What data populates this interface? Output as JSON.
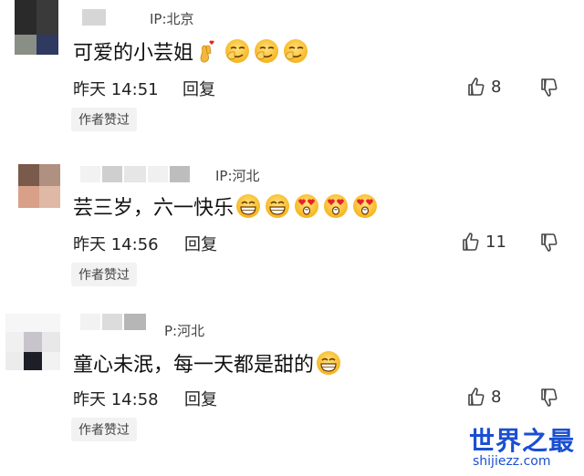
{
  "comments": [
    {
      "ip": "IP:北京",
      "text": "可爱的小芸姐",
      "emojis": [
        "finger-heart-emoji",
        "smirk-emoji",
        "smirk-emoji",
        "smirk-emoji"
      ],
      "time": "昨天 14:51",
      "reply": "回复",
      "likes": "8",
      "tag": "作者赞过"
    },
    {
      "ip": "IP:河北",
      "text": "芸三岁，六一快乐",
      "emojis": [
        "grin-emoji",
        "grin-emoji",
        "heart-eyes-emoji",
        "heart-eyes-emoji",
        "heart-eyes-emoji"
      ],
      "time": "昨天 14:56",
      "reply": "回复",
      "likes": "11",
      "tag": "作者赞过"
    },
    {
      "ip": "P:河北",
      "text": "童心未泯，每一天都是甜的",
      "emojis": [
        "grin-emoji"
      ],
      "time": "昨天 14:58",
      "reply": "回复",
      "likes": "8",
      "tag": "作者赞过"
    }
  ],
  "watermark": {
    "title": "世界之最",
    "url": "shijiezz.com"
  },
  "colors": {
    "accent": "#1a4fd1",
    "tag_bg": "#f2f2f2"
  }
}
